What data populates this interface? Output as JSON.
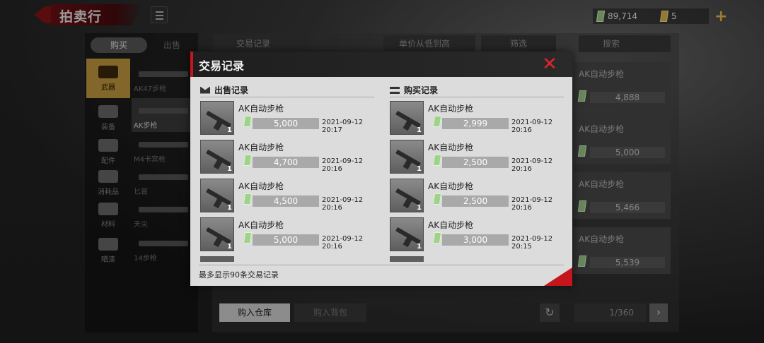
{
  "header": {
    "title": "拍卖行",
    "cash_amount": "89,714",
    "gold_amount": "5"
  },
  "left_panel": {
    "tabs": [
      "购买",
      "出售"
    ],
    "categories": [
      "武器",
      "装备",
      "配件",
      "消耗品",
      "材料",
      "晒漆"
    ],
    "subitems": [
      "AK47步枪",
      "AK步枪",
      "M4卡宾枪",
      "匕首",
      "天尖",
      "14步枪"
    ]
  },
  "main": {
    "trade_record_tab": "交易记录",
    "sort_label": "单价从低到高",
    "filter_label": "筛选",
    "search_placeholder": "搜索",
    "right_cards": [
      {
        "name": "AK自动步枪",
        "price": "4,888"
      },
      {
        "name": "AK自动步枪",
        "price": "5,000"
      },
      {
        "name": "AK自动步枪",
        "price": "5,466"
      },
      {
        "name": "AK自动步枪",
        "price": "5,539"
      }
    ],
    "warehouse_button": "购入仓库",
    "bag_button": "购入背包",
    "page_indicator": "1/360"
  },
  "modal": {
    "title": "交易记录",
    "sell_header": "出售记录",
    "buy_header": "购买记录",
    "sell_records": [
      {
        "name": "AK自动步枪",
        "qty": "1",
        "price": "5,000",
        "time": "2021-09-12 20:17"
      },
      {
        "name": "AK自动步枪",
        "qty": "1",
        "price": "4,700",
        "time": "2021-09-12 20:16"
      },
      {
        "name": "AK自动步枪",
        "qty": "1",
        "price": "4,500",
        "time": "2021-09-12 20:16"
      },
      {
        "name": "AK自动步枪",
        "qty": "1",
        "price": "5,000",
        "time": "2021-09-12 20:16"
      }
    ],
    "buy_records": [
      {
        "name": "AK自动步枪",
        "qty": "1",
        "price": "2,999",
        "time": "2021-09-12 20:16"
      },
      {
        "name": "AK自动步枪",
        "qty": "1",
        "price": "2,500",
        "time": "2021-09-12 20:16"
      },
      {
        "name": "AK自动步枪",
        "qty": "1",
        "price": "2,500",
        "time": "2021-09-12 20:16"
      },
      {
        "name": "AK自动步枪",
        "qty": "1",
        "price": "3,000",
        "time": "2021-09-12 20:15"
      }
    ],
    "footer_note": "最多显示90条交易记录"
  },
  "colors": {
    "accent_red": "#c4161c",
    "cash_green": "#9fd28a",
    "gold": "#e8b84a"
  }
}
